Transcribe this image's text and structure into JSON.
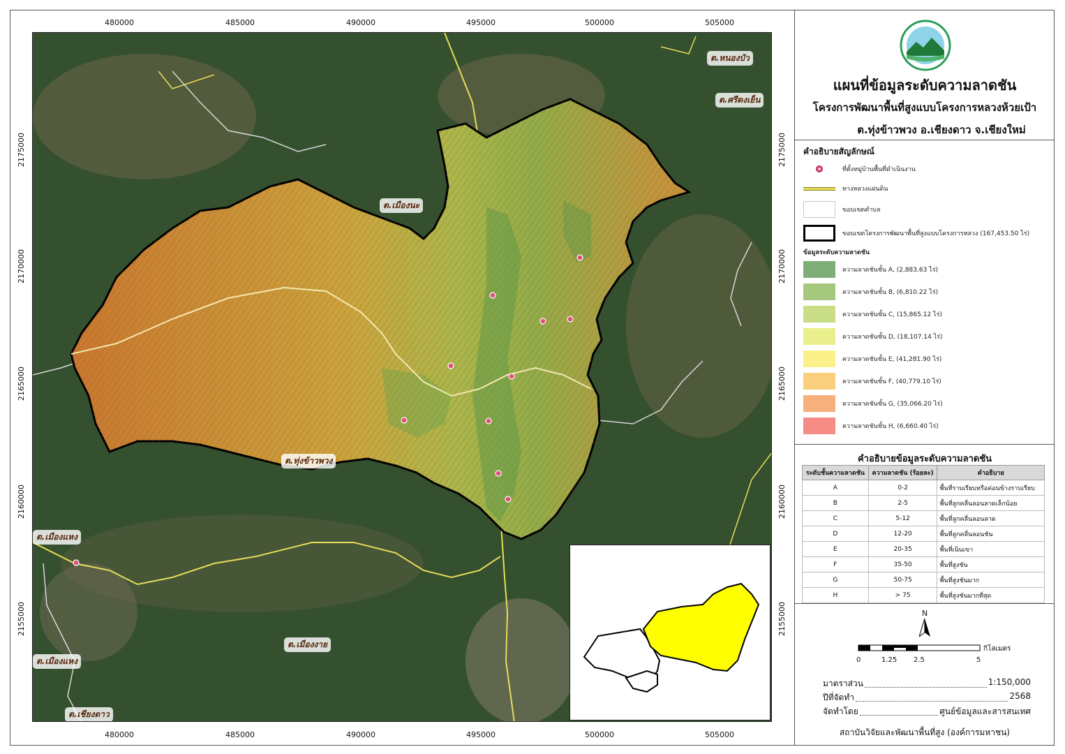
{
  "map": {
    "x_ticks": [
      "480000",
      "485000",
      "490000",
      "495000",
      "500000",
      "505000"
    ],
    "y_ticks": [
      "2175000",
      "2170000",
      "2165000",
      "2160000",
      "2155000"
    ],
    "places": {
      "nong_bua": "ต.หนองบัว",
      "si_dong_yen": "ต.ศรีดงเย็น",
      "mueang_na": "ต.เมืองนะ",
      "thung_khao_phuang": "ต.ทุ่งข้าวพวง",
      "mueang_haeng_1": "ต.เมืองแหง",
      "mueang_haeng_2": "ต.เมืองแหง",
      "mueang_ngai": "ต.เมืองงาย",
      "chiang_dao": "ต.เชียงดาว"
    }
  },
  "header": {
    "title": "แผนที่ข้อมูลระดับความลาดชัน",
    "subtitle": "โครงการพัฒนาพื้นที่สูงแบบโครงการหลวงห้วยเป้า",
    "location": "ต.ทุ่งข้าวพวง อ.เชียงดาว จ.เชียงใหม่"
  },
  "legend": {
    "heading": "คำอธิบายสัญลักษณ์",
    "village": "ที่ตั้งหมู่บ้านพื้นที่ดำเนินงาน",
    "highway": "ทางหลวงแผ่นดิน",
    "subdistrict": "ขอบเขตตำบล",
    "project": "ขอบเขตโครงการพัฒนาพื้นที่สูงแบบโครงการหลวง (167,453.50 ไร่)",
    "slope_heading": "ข้อมูลระดับความลาดชัน",
    "slope_items": [
      {
        "label": "ความลาดชันชั้น  A, (2,883.63 ไร่)",
        "color": "#7fae78"
      },
      {
        "label": "ความลาดชันชั้น  B, (6,810.22 ไร่)",
        "color": "#a6c87e"
      },
      {
        "label": "ความลาดชันชั้น  C, (15,865.12 ไร่)",
        "color": "#c9dd86"
      },
      {
        "label": "ความลาดชันชั้น  D, (18,107.14 ไร่)",
        "color": "#e9ef8c"
      },
      {
        "label": "ความลาดชันชั้น  E, (41,281.90 ไร่)",
        "color": "#fbf08a"
      },
      {
        "label": "ความลาดชันชั้น  F, (40,779.10 ไร่)",
        "color": "#f9cf7e"
      },
      {
        "label": "ความลาดชันชั้น  G, (35,066.20 ไร่)",
        "color": "#f7b07c"
      },
      {
        "label": "ความลาดชันชั้น  H, (6,660.40 ไร่)",
        "color": "#f58c86"
      }
    ]
  },
  "class_table": {
    "title": "คำอธิบายข้อมูลระดับความลาดชัน",
    "headers": [
      "ระดับชั้นความลาดชัน",
      "ความลาดชัน (ร้อยละ)",
      "คำอธิบาย"
    ],
    "rows": [
      [
        "A",
        "0-2",
        "พื้นที่ราบเรียบหรือค่อนข้างราบเรียบ"
      ],
      [
        "B",
        "2-5",
        "พื้นที่ลูกคลื่นลอนลาดเล็กน้อย"
      ],
      [
        "C",
        "5-12",
        "พื้นที่ลูกคลื่นลอนลาด"
      ],
      [
        "D",
        "12-20",
        "พื้นที่ลูกคลื่นลอนชัน"
      ],
      [
        "E",
        "20-35",
        "พื้นที่เนินเขา"
      ],
      [
        "F",
        "35-50",
        "พื้นที่สูงชัน"
      ],
      [
        "G",
        "50-75",
        "พื้นที่สูงชันมาก"
      ],
      [
        "H",
        "> 75",
        "พื้นที่สูงชันมากที่สุด"
      ]
    ]
  },
  "scale_bar": {
    "north": "N",
    "labels": [
      "0",
      "1.25",
      "2.5",
      "5"
    ],
    "unit": "กิโลเมตร"
  },
  "meta": {
    "scale_label": "มาตราส่วน",
    "scale_value": "1:150,000",
    "year_label": "ปีที่จัดทำ",
    "year_value": "2568",
    "by_label": "จัดทำโดย",
    "by_value": "ศูนย์ข้อมูลและสารสนเทศ",
    "footer": "สถาบันวิจัยและพัฒนาพื้นที่สูง (องค์การมหาชน)"
  },
  "colors": {
    "forest": "#2f4a2c",
    "boundary": "#000000",
    "highway": "#e8dc5a",
    "subdistrict": "#d8d8d8",
    "village": "#e0507a",
    "inset_fill": "#ffff00"
  }
}
